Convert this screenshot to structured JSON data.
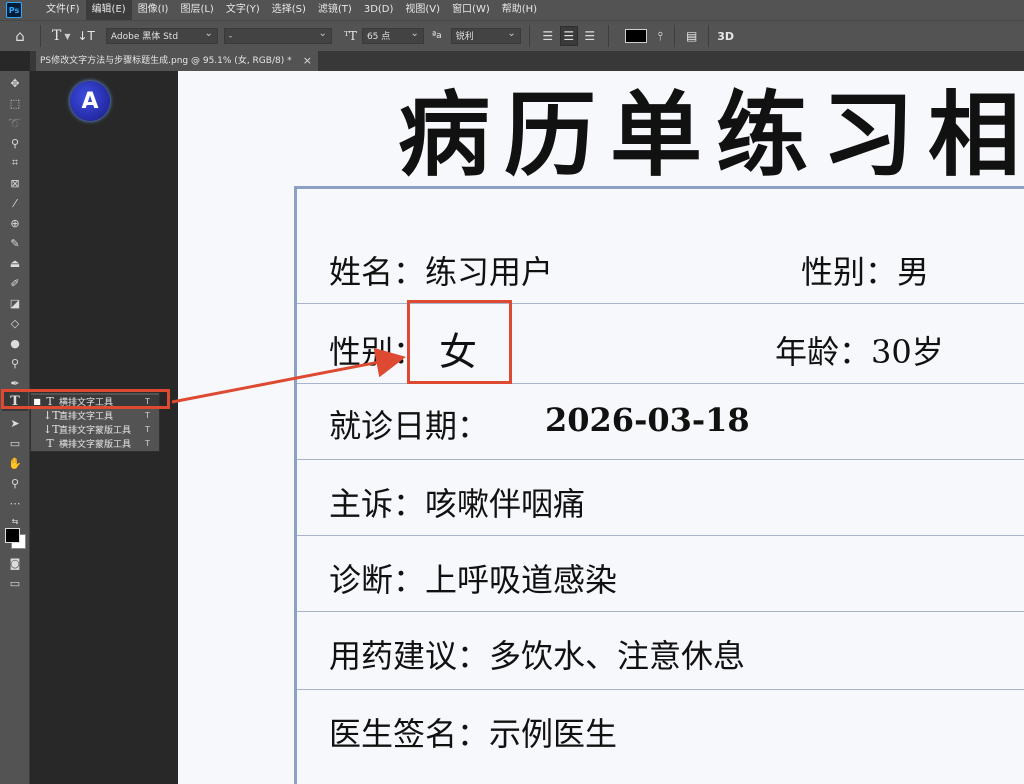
{
  "app": {
    "logo_text": "Ps"
  },
  "menu": [
    "文件(F)",
    "编辑(E)",
    "图像(I)",
    "图层(L)",
    "文字(Y)",
    "选择(S)",
    "滤镜(T)",
    "3D(D)",
    "视图(V)",
    "窗口(W)",
    "帮助(H)"
  ],
  "options": {
    "font_family": "Adobe 黑体 Std",
    "font_style": "-",
    "font_size": "65 点",
    "aa_label": "ªa",
    "anti_alias": "锐利",
    "text_color": "#000000",
    "label_3d": "3D"
  },
  "document_tab": {
    "title": "PS修改文字方法与步骤标题生成.png @ 95.1% (女, RGB/8) *",
    "close": "×"
  },
  "flyout": [
    {
      "label": "横排文字工具",
      "key": "T",
      "selected": true
    },
    {
      "label": "直排文字工具",
      "key": "T"
    },
    {
      "label": "直排文字蒙版工具",
      "key": "T"
    },
    {
      "label": "横排文字蒙版工具",
      "key": "T"
    }
  ],
  "logo_letter": "A",
  "record": {
    "title": "病历单练习相",
    "name_label": "姓名：练习用户",
    "gender_top": "性别：男",
    "gender_label": "性别：",
    "gender_value": "女",
    "age": "年龄：30岁",
    "date_label": "就诊日期：",
    "date_value": "2026-03-18",
    "complaint": "主诉：咳嗽伴咽痛",
    "diagnosis": "诊断：上呼吸道感染",
    "advice": "用药建议：多饮水、注意休息",
    "doctor": "医生签名：示例医生"
  },
  "colors": {
    "highlight": "#de4a31",
    "panel": "#535353",
    "canvas_bg": "#282828"
  }
}
